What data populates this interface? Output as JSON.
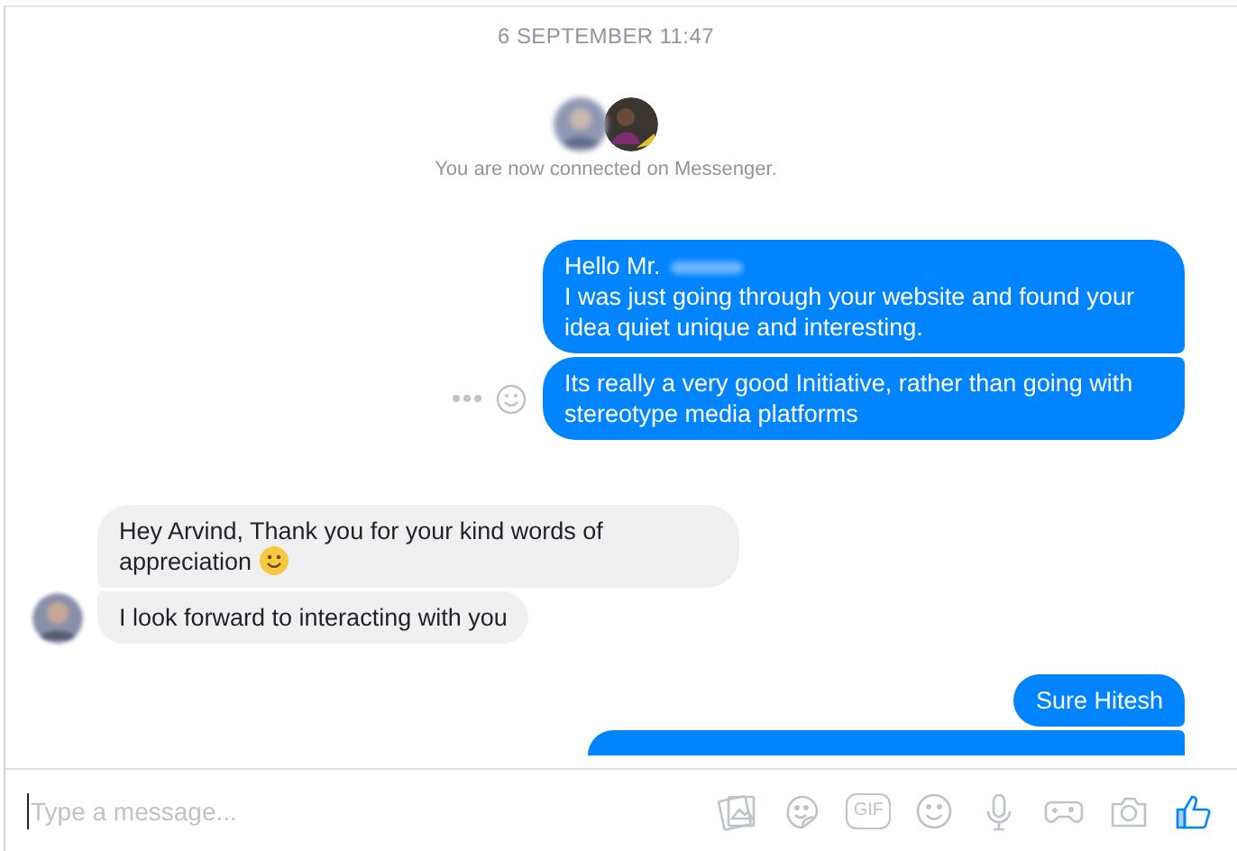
{
  "date_divider": "6 SEPTEMBER 11:47",
  "connection": {
    "avatars": [
      {
        "blurred": true
      },
      {
        "blurred": false
      }
    ],
    "text": "You are now connected on Messenger."
  },
  "groups": [
    {
      "kind": "outgoing",
      "messages": [
        {
          "text": "Hello Mr.",
          "redacted": true,
          "next_line": "I was just going through your website and found your idea quiet unique and interesting."
        }
      ]
    },
    {
      "kind": "outgoing",
      "actions": true,
      "messages": [
        {
          "text": "Its really a very good Initiative, rather than going with stereotype media platforms"
        }
      ]
    },
    {
      "kind": "incoming",
      "avatar": true,
      "messages": [
        {
          "text": "Hey Arvind, Thank you for your kind words of appreciation",
          "emoji": true
        },
        {
          "text": "I look forward to interacting with you"
        }
      ]
    },
    {
      "kind": "outgoing",
      "messages": [
        {
          "text": "Sure Hitesh"
        },
        {
          "cut": true
        }
      ]
    }
  ],
  "composer": {
    "placeholder": "Type a message...",
    "tools": [
      {
        "kind": "photos"
      },
      {
        "kind": "sticker"
      },
      {
        "kind": "gif",
        "label": "GIF"
      },
      {
        "kind": "emoji"
      },
      {
        "kind": "mic"
      },
      {
        "kind": "game"
      },
      {
        "kind": "camera"
      },
      {
        "kind": "like"
      }
    ]
  }
}
